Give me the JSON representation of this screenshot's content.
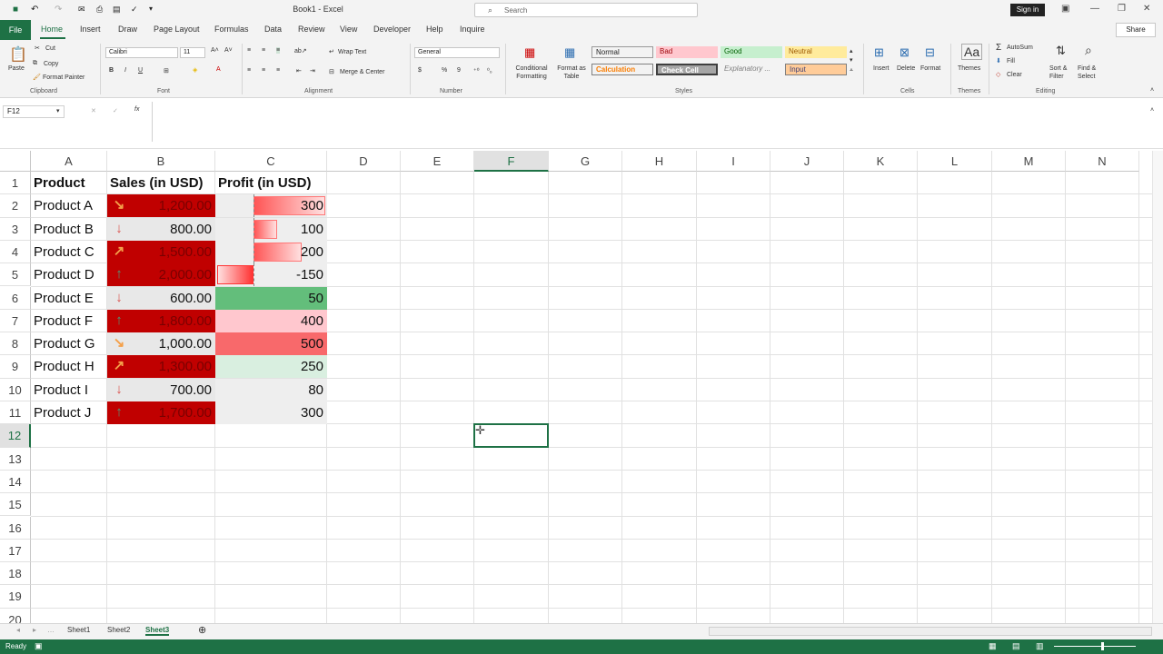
{
  "window": {
    "title": "Book1 - Excel",
    "search_placeholder": "Search",
    "sign_in": "Sign in"
  },
  "tabs": [
    "File",
    "Home",
    "Insert",
    "Draw",
    "Page Layout",
    "Formulas",
    "Data",
    "Review",
    "View",
    "Developer",
    "Help",
    "Inquire"
  ],
  "share": "Share",
  "ribbon": {
    "clipboard": {
      "paste": "Paste",
      "cut": "Cut",
      "copy": "Copy",
      "format_painter": "Format Painter",
      "label": "Clipboard"
    },
    "font": {
      "name": "Calibri",
      "size": "11",
      "label": "Font"
    },
    "alignment": {
      "wrap": "Wrap Text",
      "merge": "Merge & Center",
      "label": "Alignment"
    },
    "number": {
      "format": "General",
      "label": "Number"
    },
    "styles": {
      "conditional": "Conditional Formatting",
      "format_table": "Format as Table",
      "cells": [
        {
          "label": "Normal",
          "bg": "#ffffff",
          "fg": "#000000"
        },
        {
          "label": "Bad",
          "bg": "#ffc7ce",
          "fg": "#9c0006"
        },
        {
          "label": "Good",
          "bg": "#c6efce",
          "fg": "#006100"
        },
        {
          "label": "Neutral",
          "bg": "#ffeb9c",
          "fg": "#9c5700"
        },
        {
          "label": "Calculation",
          "bg": "#f2f2f2",
          "fg": "#fa7d00"
        },
        {
          "label": "Check Cell",
          "bg": "#a5a5a5",
          "fg": "#ffffff"
        },
        {
          "label": "Explanatory ...",
          "bg": "#ffffff",
          "fg": "#7f7f7f"
        },
        {
          "label": "Input",
          "bg": "#ffcc99",
          "fg": "#3f3f76"
        }
      ],
      "label": "Styles"
    },
    "cells": {
      "insert": "Insert",
      "delete": "Delete",
      "format": "Format",
      "label": "Cells"
    },
    "themes": {
      "themes": "Themes",
      "label": "Themes"
    },
    "editing": {
      "autosum": "AutoSum",
      "fill": "Fill",
      "clear": "Clear",
      "sort": "Sort & Filter",
      "find": "Find & Select",
      "label": "Editing"
    }
  },
  "name_box": "F12",
  "columns": [
    "A",
    "B",
    "C",
    "D",
    "E",
    "F",
    "G",
    "H",
    "I",
    "J",
    "K",
    "L",
    "M",
    "N"
  ],
  "rows": [
    "1",
    "2",
    "3",
    "4",
    "5",
    "6",
    "7",
    "8",
    "9",
    "10",
    "11",
    "12",
    "13",
    "14",
    "15",
    "16",
    "17",
    "18",
    "19",
    "20"
  ],
  "table": {
    "headers": [
      "Product",
      "Sales (in USD)",
      "Profit (in USD)"
    ],
    "rows": [
      {
        "product": "Product A",
        "sales": "1,200.00",
        "profit": "300",
        "arrow": "↘",
        "arrow_color": "#f4a04a",
        "sales_fill": "red",
        "profit_bar": 0.6,
        "profit_fill": "bar"
      },
      {
        "product": "Product B",
        "sales": "800.00",
        "profit": "100",
        "arrow": "↓",
        "arrow_color": "#d9534f",
        "sales_fill": "none",
        "profit_bar": 0.2,
        "profit_fill": "bar"
      },
      {
        "product": "Product C",
        "sales": "1,500.00",
        "profit": "200",
        "arrow": "↗",
        "arrow_color": "#f4a04a",
        "sales_fill": "red",
        "profit_bar": 0.4,
        "profit_fill": "bar"
      },
      {
        "product": "Product D",
        "sales": "2,000.00",
        "profit": "-150",
        "arrow": "↑",
        "arrow_color": "#4a9a7a",
        "sales_fill": "red",
        "profit_bar": -0.3,
        "profit_fill": "negbar"
      },
      {
        "product": "Product E",
        "sales": "600.00",
        "profit": "50",
        "arrow": "↓",
        "arrow_color": "#d9534f",
        "sales_fill": "none",
        "profit_bar": 0,
        "profit_fill": "green"
      },
      {
        "product": "Product F",
        "sales": "1,800.00",
        "profit": "400",
        "arrow": "↑",
        "arrow_color": "#4a9a7a",
        "sales_fill": "red",
        "profit_bar": 0,
        "profit_fill": "pink"
      },
      {
        "product": "Product G",
        "sales": "1,000.00",
        "profit": "500",
        "arrow": "↘",
        "arrow_color": "#f4a04a",
        "sales_fill": "none",
        "profit_bar": 0,
        "profit_fill": "salmon"
      },
      {
        "product": "Product H",
        "sales": "1,300.00",
        "profit": "250",
        "arrow": "↗",
        "arrow_color": "#f4a04a",
        "sales_fill": "red",
        "profit_bar": 0,
        "profit_fill": "lightgreen"
      },
      {
        "product": "Product I",
        "sales": "700.00",
        "profit": "80",
        "arrow": "↓",
        "arrow_color": "#d9534f",
        "sales_fill": "none",
        "profit_bar": 0,
        "profit_fill": "none"
      },
      {
        "product": "Product J",
        "sales": "1,700.00",
        "profit": "300",
        "arrow": "↑",
        "arrow_color": "#4a9a7a",
        "sales_fill": "red",
        "profit_bar": 0,
        "profit_fill": "none"
      }
    ]
  },
  "sheets": [
    "Sheet1",
    "Sheet2",
    "Sheet3"
  ],
  "active_sheet": "Sheet3",
  "status": "Ready"
}
